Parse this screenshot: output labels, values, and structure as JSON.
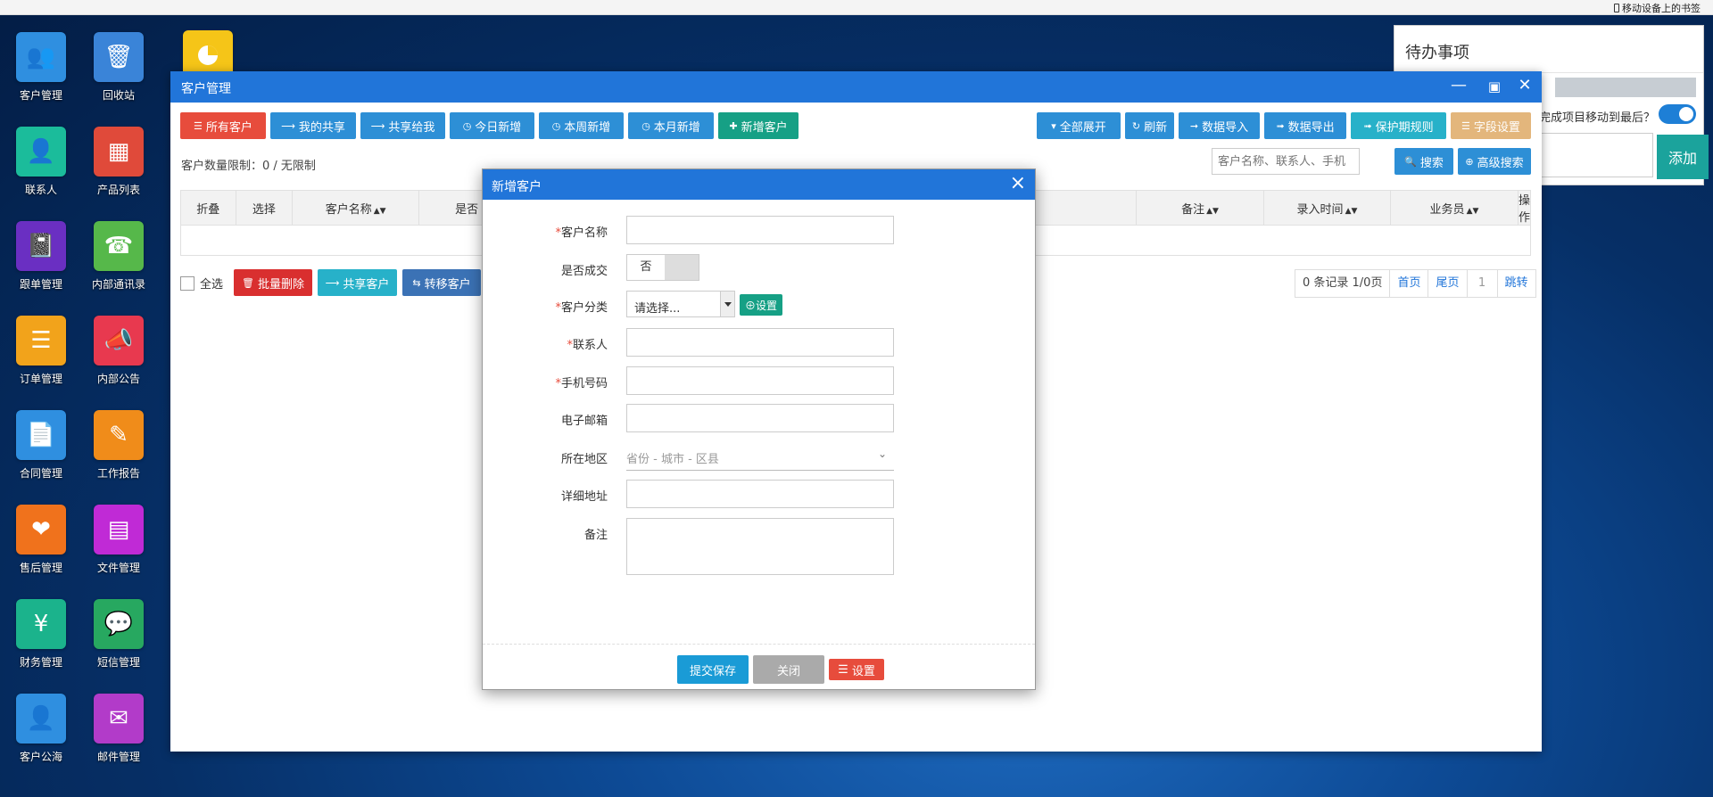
{
  "browser": {
    "bookmarks_label": "移动设备上的书签"
  },
  "desktop": {
    "icons": [
      {
        "label": "客户管理",
        "color": "#2f8fe0",
        "icon": "users-icon"
      },
      {
        "label": "回收站",
        "color": "#3a84d8",
        "icon": "trash-icon"
      },
      {
        "label": "联系人",
        "color": "#1bbc9b",
        "icon": "contact-icon"
      },
      {
        "label": "产品列表",
        "color": "#e04a3a",
        "icon": "grid-icon"
      },
      {
        "label": "跟单管理",
        "color": "#6a2fc2",
        "icon": "notebook-icon"
      },
      {
        "label": "内部通讯录",
        "color": "#56b84a",
        "icon": "phone-book-icon"
      },
      {
        "label": "订单管理",
        "color": "#f2a31b",
        "icon": "order-icon"
      },
      {
        "label": "内部公告",
        "color": "#e8394f",
        "icon": "megaphone-icon"
      },
      {
        "label": "合同管理",
        "color": "#2f8fe0",
        "icon": "contract-icon"
      },
      {
        "label": "工作报告",
        "color": "#f08c1a",
        "icon": "report-icon"
      },
      {
        "label": "售后管理",
        "color": "#f0721c",
        "icon": "handshake-icon"
      },
      {
        "label": "文件管理",
        "color": "#c02ad6",
        "icon": "file-icon"
      },
      {
        "label": "财务管理",
        "color": "#1bb38c",
        "icon": "finance-icon"
      },
      {
        "label": "短信管理",
        "color": "#27a860",
        "icon": "sms-icon"
      },
      {
        "label": "客户公海",
        "color": "#2f8fe0",
        "icon": "user-sea-icon"
      },
      {
        "label": "邮件管理",
        "color": "#b23bc9",
        "icon": "mail-icon"
      }
    ]
  },
  "todo": {
    "title": "待办事项",
    "question": "完成项目移动到最后？",
    "add_label": "添加"
  },
  "window": {
    "title": "客户管理",
    "toolbar_left": [
      {
        "label": "所有客户",
        "icon": "list-icon",
        "color": "#e74c3c"
      },
      {
        "label": "我的共享",
        "icon": "share-icon",
        "color": "#2d8fd6"
      },
      {
        "label": "共享给我",
        "icon": "share-icon",
        "color": "#2d8fd6"
      },
      {
        "label": "今日新增",
        "icon": "clock-icon",
        "color": "#2d8fd6"
      },
      {
        "label": "本周新增",
        "icon": "clock-icon",
        "color": "#2d8fd6"
      },
      {
        "label": "本月新增",
        "icon": "clock-icon",
        "color": "#2d8fd6"
      },
      {
        "label": "新增客户",
        "icon": "plus-icon",
        "color": "#16a085"
      }
    ],
    "toolbar_right": [
      {
        "label": "全部展开",
        "icon": "caret-down-icon",
        "color": "#2d8fd6"
      },
      {
        "label": "刷新",
        "icon": "refresh-icon",
        "color": "#2d8fd6"
      },
      {
        "label": "数据导入",
        "icon": "import-icon",
        "color": "#2d8fd6"
      },
      {
        "label": "数据导出",
        "icon": "export-icon",
        "color": "#2d8fd6"
      },
      {
        "label": "保护期规则",
        "icon": "export-icon",
        "color": "#27b1c9"
      },
      {
        "label": "字段设置",
        "icon": "list-icon",
        "color": "#e3b67c"
      }
    ],
    "limit_text": "客户数量限制：0 / 无限制",
    "search": {
      "placeholder": "客户名称、联系人、手机",
      "search_label": "搜索",
      "advanced_label": "高级搜索"
    },
    "columns": [
      "折叠",
      "选择",
      "客户名称",
      "是否",
      "备注",
      "录入时间",
      "业务员",
      "操作"
    ],
    "bottom": {
      "select_all": "全选",
      "batch_delete": "批量删除",
      "share_customer": "共享客户",
      "transfer_customer": "转移客户"
    },
    "pager": {
      "summary": "0 条记录 1/0页",
      "first": "首页",
      "last": "尾页",
      "page": "1",
      "jump": "跳转"
    }
  },
  "modal": {
    "title": "新增客户",
    "fields": {
      "name": "客户名称",
      "deal": "是否成交",
      "deal_value": "否",
      "category": "客户分类",
      "category_value": "请选择...",
      "category_set": "设置",
      "contact": "联系人",
      "phone": "手机号码",
      "email": "电子邮箱",
      "region": "所在地区",
      "region_value": "省份 - 城市 - 区县",
      "address": "详细地址",
      "memo": "备注"
    },
    "buttons": {
      "submit": "提交保存",
      "close": "关闭",
      "settings": "设置"
    }
  }
}
